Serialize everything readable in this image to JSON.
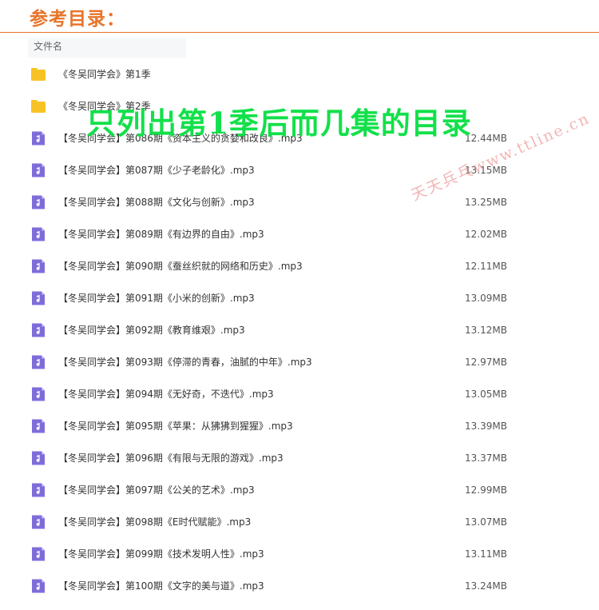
{
  "page": {
    "title": "参考目录：",
    "column_header": "文件名",
    "overlay_note": "只列出第1季后而几集的目录",
    "watermark": "天天兵乓www.ttline.cn"
  },
  "colors": {
    "title": "#e8742a",
    "folder_icon": "#f7c325",
    "audio_icon": "#7f6cdb",
    "overlay": "#12e04a"
  },
  "files": [
    {
      "icon": "folder-icon",
      "name": "《冬吴同学会》第1季",
      "size": ""
    },
    {
      "icon": "folder-icon",
      "name": "《冬吴同学会》第2季",
      "size": ""
    },
    {
      "icon": "audio-file-icon",
      "name": "【冬吴同学会】第086期《资本主义的贪婪和改良》.mp3",
      "size": "12.44MB"
    },
    {
      "icon": "audio-file-icon",
      "name": "【冬吴同学会】第087期《少子老龄化》.mp3",
      "size": "13.15MB"
    },
    {
      "icon": "audio-file-icon",
      "name": "【冬吴同学会】第088期《文化与创新》.mp3",
      "size": "13.25MB"
    },
    {
      "icon": "audio-file-icon",
      "name": "【冬吴同学会】第089期《有边界的自由》.mp3",
      "size": "12.02MB"
    },
    {
      "icon": "audio-file-icon",
      "name": "【冬吴同学会】第090期《蚕丝织就的网络和历史》.mp3",
      "size": "12.11MB"
    },
    {
      "icon": "audio-file-icon",
      "name": "【冬吴同学会】第091期《小米的创新》.mp3",
      "size": "13.09MB"
    },
    {
      "icon": "audio-file-icon",
      "name": "【冬吴同学会】第092期《教育维艰》.mp3",
      "size": "13.12MB"
    },
    {
      "icon": "audio-file-icon",
      "name": "【冬吴同学会】第093期《停滞的青春，油腻的中年》.mp3",
      "size": "12.97MB"
    },
    {
      "icon": "audio-file-icon",
      "name": "【冬吴同学会】第094期《无好奇，不迭代》.mp3",
      "size": "13.05MB"
    },
    {
      "icon": "audio-file-icon",
      "name": "【冬吴同学会】第095期《苹果：从狒狒到猩猩》.mp3",
      "size": "13.39MB"
    },
    {
      "icon": "audio-file-icon",
      "name": "【冬吴同学会】第096期《有限与无限的游戏》.mp3",
      "size": "13.37MB"
    },
    {
      "icon": "audio-file-icon",
      "name": "【冬吴同学会】第097期《公关的艺术》.mp3",
      "size": "12.99MB"
    },
    {
      "icon": "audio-file-icon",
      "name": "【冬吴同学会】第098期《E时代赋能》.mp3",
      "size": "13.07MB"
    },
    {
      "icon": "audio-file-icon",
      "name": "【冬吴同学会】第099期《技术发明人性》.mp3",
      "size": "13.11MB"
    },
    {
      "icon": "audio-file-icon",
      "name": "【冬吴同学会】第100期《文字的美与道》.mp3",
      "size": "13.24MB"
    }
  ]
}
